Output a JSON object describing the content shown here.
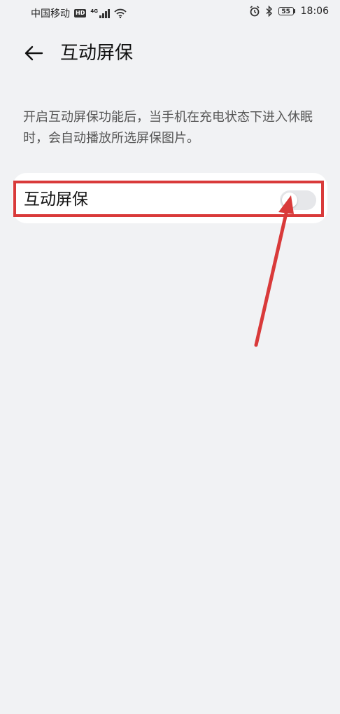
{
  "status_bar": {
    "carrier": "中国移动",
    "hd_label": "HD",
    "network": "4G",
    "battery": "55",
    "time": "18:06"
  },
  "header": {
    "back_icon": "arrow-left-icon",
    "title": "互动屏保"
  },
  "description": "开启互动屏保功能后，当手机在充电状态下进入休眠时，会自动播放所选屏保图片。",
  "setting": {
    "label": "互动屏保",
    "enabled": false
  },
  "colors": {
    "background": "#f1f2f4",
    "card": "#ffffff",
    "highlight": "#d93a3a",
    "toggle_off": "#e6e7ea"
  }
}
